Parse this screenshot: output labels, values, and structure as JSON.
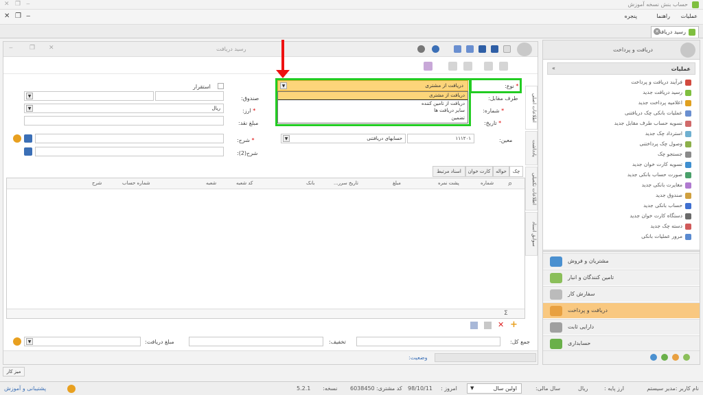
{
  "app": {
    "title": "حساب بنش نسخه آموزش",
    "menu": [
      "عملیات",
      "راهنما",
      "پنجره"
    ],
    "doc_tab": "رسید دریافت"
  },
  "doc": {
    "title": "رسید دریافت",
    "form": {
      "type_label": "نوع:",
      "type_value": "دریافت از مشتری",
      "counterparty_label": "طرف مقابل:",
      "number_label": "شماره:",
      "date_label": "تاریخ:",
      "account_label": "معین:",
      "account_code": "۱۱۱۲۰۱",
      "account_name": "حسابهای دریافتنی",
      "fund_label": "صندوق:",
      "currency_label": "ارز:",
      "currency_value": "ریال",
      "cash_label": "مبلغ نقد:",
      "desc_label": "شرح:",
      "desc2_label": "شرح(2):",
      "stability_label": "استقرار"
    },
    "dropdown_options": [
      "دریافت از مشتری",
      "دریافت از تامین کننده",
      "سایر دریافت ها",
      "تضمین"
    ],
    "side_tabs": [
      "اطلاعات اصلی",
      "یادداشت",
      "اطلاعات تکمیلی",
      "سوابق اسناد"
    ],
    "grid_tabs": [
      "چک",
      "حواله",
      "کارت خوان",
      "اسناد مرتبط"
    ],
    "grid_columns": [
      "شماره",
      "پشت نمره",
      "مبلغ",
      "تاریخ سرر...",
      "بانک",
      "کد شعبه",
      "شعبه",
      "شماره حساب",
      "شرح"
    ],
    "footer": {
      "total_label": "جمع کل:",
      "discount_label": "تخفیف:",
      "received_label": "مبلغ دریافت:",
      "status_label": "وضعیت:"
    }
  },
  "right_panel": {
    "title": "دریافت و پرداخت",
    "ops_title": "عملیات",
    "ops": [
      {
        "label": "فرآیند دریافت و پرداخت",
        "color": "#d24b3f"
      },
      {
        "label": "رسید دریافت جدید",
        "color": "#7fbf3f"
      },
      {
        "label": "اعلامیه پرداخت جدید",
        "color": "#e0a020"
      },
      {
        "label": "عملیات بانکی چک دریافتنی",
        "color": "#6a8fd0"
      },
      {
        "label": "تسویه حساب طرف مقابل جدید",
        "color": "#d06a6a"
      },
      {
        "label": "استرداد چک جدید",
        "color": "#6fb0d0"
      },
      {
        "label": "وصول چک پرداختنی",
        "color": "#8cb04a"
      },
      {
        "label": "جستجو چک",
        "color": "#8a8a8a"
      },
      {
        "label": "تسویه کارت خوان جدید",
        "color": "#3f8fd0"
      },
      {
        "label": "صورت حساب بانکی جدید",
        "color": "#4aa06a"
      },
      {
        "label": "مغایرت بانکی جدید",
        "color": "#b07ad0"
      },
      {
        "label": "صندوق جدید",
        "color": "#d0a03f"
      },
      {
        "label": "حساب بانکی جدید",
        "color": "#3f6fd0"
      },
      {
        "label": "دستگاه کارت خوان جدید",
        "color": "#6a6a6a"
      },
      {
        "label": "دسته چک جدید",
        "color": "#d05a5a"
      },
      {
        "label": "مرور عملیات بانکی",
        "color": "#5a8ad0"
      }
    ],
    "modules": [
      {
        "label": "مشتریان و فروش",
        "color": "#4a90d0",
        "active": false
      },
      {
        "label": "تامین کنندگان و انبار",
        "color": "#8bbf5a",
        "active": false
      },
      {
        "label": "سفارش کار",
        "color": "#bbbbbb",
        "active": false
      },
      {
        "label": "دریافت و پرداخت",
        "color": "#e8a040",
        "active": true
      },
      {
        "label": "دارایی ثابت",
        "color": "#a0a0a0",
        "active": false
      },
      {
        "label": "حسابداری",
        "color": "#6ab04a",
        "active": false
      }
    ]
  },
  "tiny_tab": "میز کار",
  "statusbar": {
    "user": "نام کاربر :مدیر سیستم",
    "base_currency_label": "ارز پایه :",
    "base_currency": "ریال",
    "fiscal_year_label": "سال مالی:",
    "fiscal_year": "اولین سال",
    "today_label": "امروز :",
    "today": "98/10/11",
    "customer_code_label": "کد مشتری:",
    "customer_code": "6038450",
    "version_label": "نسخه:",
    "version": "5.2.1",
    "support": "پشتیبانی و آموزش"
  }
}
